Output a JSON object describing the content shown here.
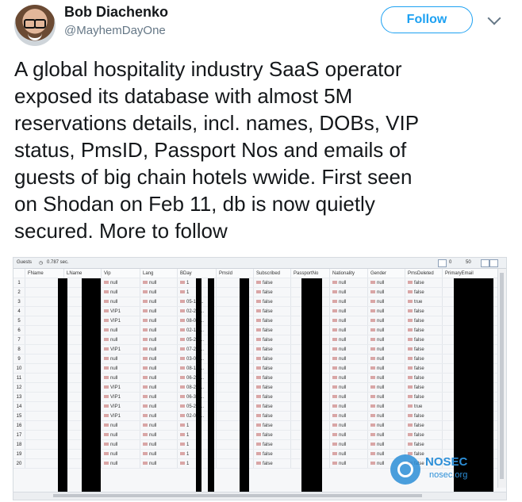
{
  "tweet": {
    "author_name": "Bob Diachenko",
    "author_handle": "@MayhemDayOne",
    "follow_label": "Follow",
    "text_lines": [
      "A global hospitality industry SaaS operator",
      "exposed its database with almost 5M",
      "reservations details, incl. names, DOBs, VIP",
      "status, PmsID, Passport Nos and emails of",
      "guests of big chain hotels wwide. First seen",
      "on Shodan on Feb 11, db is now quietly",
      "secured. More to follow"
    ]
  },
  "screenshot": {
    "collection_label": "Guests",
    "time_label": "0.787 sec.",
    "pagination": {
      "from": "0",
      "to": "50"
    },
    "columns": [
      "FName",
      "LName",
      "Vip",
      "Lang",
      "BDay",
      "PmsId",
      "Subscribed",
      "PassportNo",
      "Nationality",
      "Gender",
      "PmsDeleted",
      "PrimaryEmail"
    ],
    "rows": [
      {
        "num": "1",
        "vip": "null",
        "lang": "null",
        "bday": "1",
        "subscribed": "false",
        "nationality": "null",
        "gender": "null",
        "pms_deleted": "false"
      },
      {
        "num": "2",
        "vip": "null",
        "lang": "null",
        "bday": "1",
        "subscribed": "false",
        "nationality": "null",
        "gender": "null",
        "pms_deleted": "false"
      },
      {
        "num": "3",
        "vip": "null",
        "lang": "null",
        "bday": "05-11 ...",
        "subscribed": "false",
        "nationality": "null",
        "gender": "null",
        "pms_deleted": "true"
      },
      {
        "num": "4",
        "vip": "VIP1",
        "lang": "null",
        "bday": "02-20 ...",
        "subscribed": "false",
        "nationality": "null",
        "gender": "null",
        "pms_deleted": "false"
      },
      {
        "num": "5",
        "vip": "VIP1",
        "lang": "null",
        "bday": "08-05 ...",
        "subscribed": "false",
        "nationality": "null",
        "gender": "null",
        "pms_deleted": "false"
      },
      {
        "num": "6",
        "vip": "null",
        "lang": "null",
        "bday": "02-14 ...",
        "subscribed": "false",
        "nationality": "null",
        "gender": "null",
        "pms_deleted": "false"
      },
      {
        "num": "7",
        "vip": "null",
        "lang": "null",
        "bday": "05-26 ...",
        "subscribed": "false",
        "nationality": "null",
        "gender": "null",
        "pms_deleted": "false"
      },
      {
        "num": "8",
        "vip": "VIP1",
        "lang": "null",
        "bday": "07-21 ...",
        "subscribed": "false",
        "nationality": "null",
        "gender": "null",
        "pms_deleted": "false"
      },
      {
        "num": "9",
        "vip": "null",
        "lang": "null",
        "bday": "03-04 ...",
        "subscribed": "false",
        "nationality": "null",
        "gender": "null",
        "pms_deleted": "false"
      },
      {
        "num": "10",
        "vip": "null",
        "lang": "null",
        "bday": "08-18 ...",
        "subscribed": "false",
        "nationality": "null",
        "gender": "null",
        "pms_deleted": "false"
      },
      {
        "num": "11",
        "vip": "null",
        "lang": "null",
        "bday": "06-28 ...",
        "subscribed": "false",
        "nationality": "null",
        "gender": "null",
        "pms_deleted": "false"
      },
      {
        "num": "12",
        "vip": "VIP1",
        "lang": "null",
        "bday": "08-28 ...",
        "subscribed": "false",
        "nationality": "null",
        "gender": "null",
        "pms_deleted": "false"
      },
      {
        "num": "13",
        "vip": "VIP1",
        "lang": "null",
        "bday": "06-30 ...",
        "subscribed": "false",
        "nationality": "null",
        "gender": "null",
        "pms_deleted": "false"
      },
      {
        "num": "14",
        "vip": "VIP1",
        "lang": "null",
        "bday": "05-21 ...",
        "subscribed": "false",
        "nationality": "null",
        "gender": "null",
        "pms_deleted": "true"
      },
      {
        "num": "15",
        "vip": "VIP1",
        "lang": "null",
        "bday": "02-06 ...",
        "subscribed": "false",
        "nationality": "null",
        "gender": "null",
        "pms_deleted": "false"
      },
      {
        "num": "16",
        "vip": "null",
        "lang": "null",
        "bday": "1",
        "subscribed": "false",
        "nationality": "null",
        "gender": "null",
        "pms_deleted": "false"
      },
      {
        "num": "17",
        "vip": "null",
        "lang": "null",
        "bday": "1",
        "subscribed": "false",
        "nationality": "null",
        "gender": "null",
        "pms_deleted": "false"
      },
      {
        "num": "18",
        "vip": "null",
        "lang": "null",
        "bday": "1",
        "subscribed": "false",
        "nationality": "null",
        "gender": "null",
        "pms_deleted": "false"
      },
      {
        "num": "19",
        "vip": "null",
        "lang": "null",
        "bday": "1",
        "subscribed": "false",
        "nationality": "null",
        "gender": "null",
        "pms_deleted": "false"
      },
      {
        "num": "20",
        "vip": "null",
        "lang": "null",
        "bday": "1",
        "subscribed": "false",
        "nationality": "null",
        "gender": "null",
        "pms_deleted": "false"
      }
    ]
  },
  "watermark": {
    "title": "NOSEC",
    "subtitle": "nosec.org"
  },
  "colors": {
    "brand_blue": "#1da1f2",
    "watermark_blue": "#2d8fd8"
  }
}
